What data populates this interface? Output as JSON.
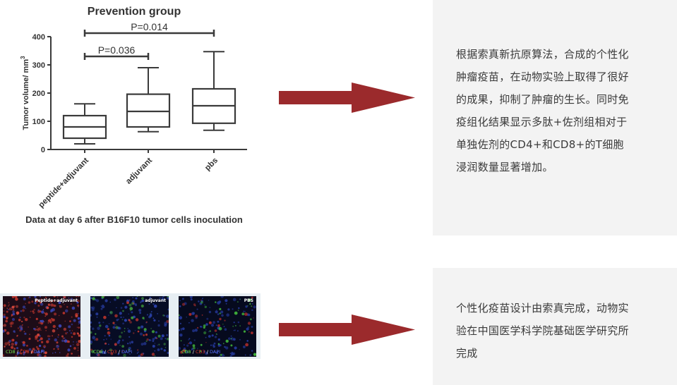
{
  "chart_data": {
    "type": "boxplot",
    "title": "Prevention group",
    "ylabel": "Tumor volume/ mm3",
    "xlabel": "Data at day 6 after B16F10 tumor cells inoculation",
    "ylim": [
      0,
      400
    ],
    "yticks": [
      0,
      100,
      200,
      300,
      400
    ],
    "categories": [
      "peptide+adjuvant",
      "adjuvant",
      "pbs"
    ],
    "boxes": [
      {
        "min": 20,
        "q1": 40,
        "median": 80,
        "q3": 120,
        "max": 162
      },
      {
        "min": 63,
        "q1": 80,
        "median": 135,
        "q3": 196,
        "max": 290
      },
      {
        "min": 68,
        "q1": 93,
        "median": 155,
        "q3": 215,
        "max": 347
      }
    ],
    "annotations": [
      {
        "text": "P=0.036",
        "from": 0,
        "to": 1
      },
      {
        "text": "P=0.014",
        "from": 0,
        "to": 2
      }
    ]
  },
  "card1": {
    "lines": [
      "根据索真新抗原算法，合成的个性化",
      "肿瘤疫苗，在动物实验上取得了很好",
      "的成果，抑制了肿瘤的生长。同时免",
      "疫组化结果显示多肽+佐剂组相对于",
      "单独佐剂的CD4+和CD8+的T细胞",
      "浸润数量显著增加。"
    ]
  },
  "card2": {
    "lines": [
      "个性化疫苗设计由索真完成，动物实",
      "验在中国医学科学院基础医学研究所",
      "完成"
    ]
  },
  "micro": {
    "panels": [
      {
        "tag": "Peptide+adjuvant",
        "stain": {
          "cd8": "CD8",
          "cd3": "CD3",
          "dapi": "DAPI",
          "sep": " / "
        }
      },
      {
        "tag": "adjuvant",
        "stain": {
          "cd8": "CD8",
          "cd3": "CD3",
          "dapi": "DAPI",
          "sep": " / "
        }
      },
      {
        "tag": "PBS",
        "stain": {
          "cd8": "CD8",
          "cd3": "CD3",
          "dapi": "DAPI",
          "sep": " / "
        }
      }
    ]
  },
  "colors": {
    "arrow": "#9b2a2c",
    "card_bg": "#f3f3f3",
    "cd8": "#6fe24a",
    "cd3": "#e23a2a",
    "dapi": "#5b74ff"
  }
}
